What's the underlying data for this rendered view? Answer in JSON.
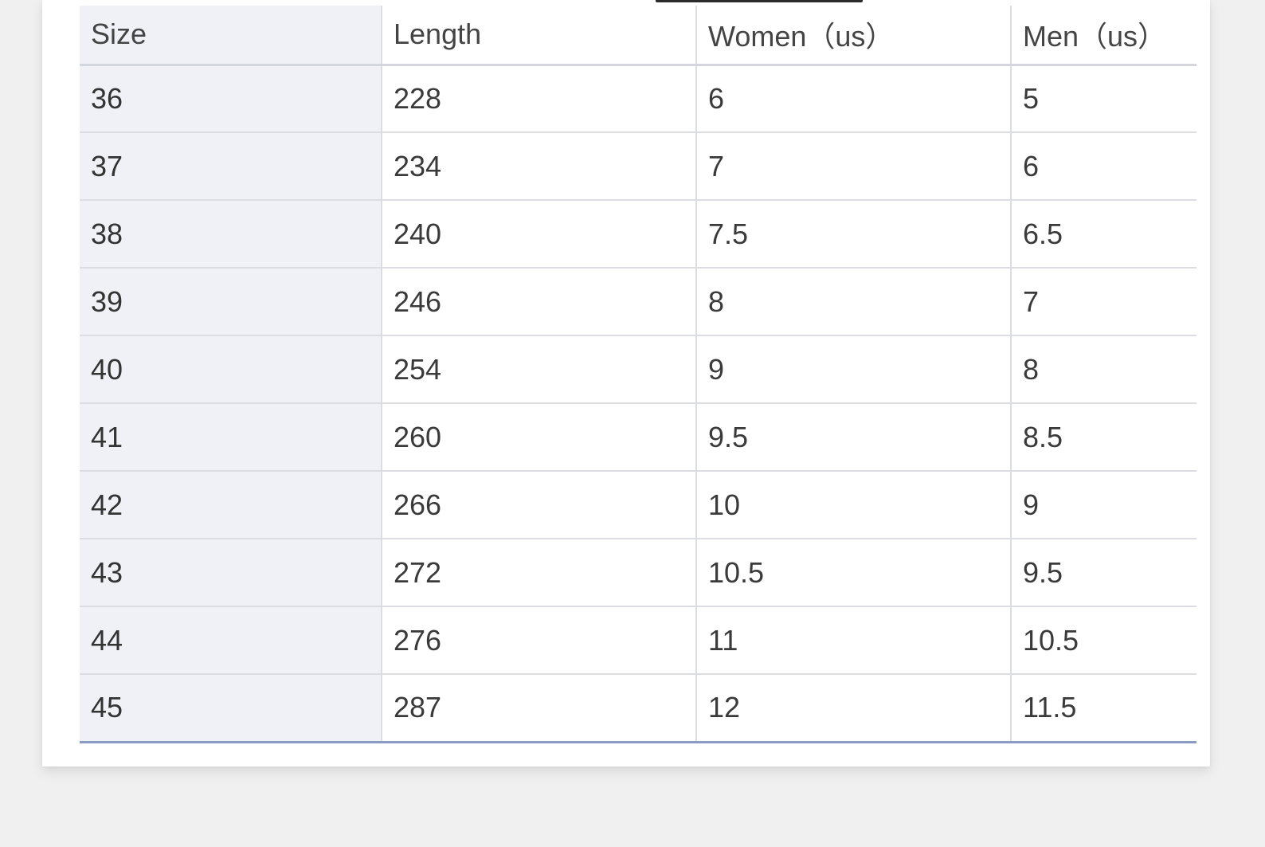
{
  "table": {
    "headers": [
      "Size",
      "Length",
      "Women（us）",
      "Men（us）"
    ],
    "rows": [
      [
        "36",
        "228",
        "6",
        "5"
      ],
      [
        "37",
        "234",
        "7",
        "6"
      ],
      [
        "38",
        "240",
        "7.5",
        "6.5"
      ],
      [
        "39",
        "246",
        "8",
        "7"
      ],
      [
        "40",
        "254",
        "9",
        "8"
      ],
      [
        "41",
        "260",
        "9.5",
        "8.5"
      ],
      [
        "42",
        "266",
        "10",
        "9"
      ],
      [
        "43",
        "272",
        "10.5",
        "9.5"
      ],
      [
        "44",
        "276",
        "11",
        "10.5"
      ],
      [
        "45",
        "287",
        "12",
        "11.5"
      ]
    ]
  },
  "colors": {
    "card_background": "#ffffff",
    "page_background": "#f0f0f0",
    "first_column_background": "#f0f1f6",
    "grid_line": "#dcdde3",
    "bottom_rule": "#8b9cc4",
    "text": "#3a3a3a"
  }
}
